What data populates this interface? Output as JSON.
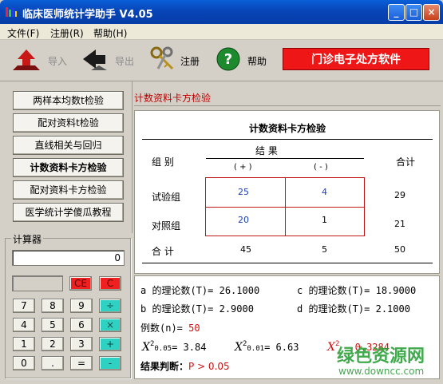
{
  "window": {
    "title": "临床医师统计学助手 V4.05",
    "minimize": "_",
    "maximize": "□",
    "close": "×"
  },
  "menu": {
    "items": [
      "文件(F)",
      "注册(R)",
      "帮助(H)"
    ]
  },
  "toolbar": {
    "import_label": "导入",
    "export_label": "导出",
    "register_label": "注册",
    "help_label": "帮助",
    "help_glyph": "?",
    "banner": "门诊电子处方软件"
  },
  "nav": {
    "items": [
      "两样本均数t检验",
      "配对资料t检验",
      "直线相关与回归",
      "计数资料卡方检验",
      "配对资料卡方检验",
      "医学统计学傻瓜教程"
    ],
    "active_index": 3
  },
  "calculator": {
    "title": "计算器",
    "display": "0",
    "ce": "CE",
    "c": "C",
    "keys": [
      "7",
      "8",
      "9",
      "÷",
      "4",
      "5",
      "6",
      "×",
      "1",
      "2",
      "3",
      "+",
      "0",
      ".",
      "=",
      "-"
    ]
  },
  "section_title": "计数资料卡方检验",
  "table": {
    "title": "计数资料卡方检验",
    "group_header": "组    别",
    "result_header": "结        果",
    "pos_header": "( + )",
    "neg_header": "( - )",
    "total_header": "合计",
    "rows": [
      {
        "label": "试验组",
        "pos": "25",
        "neg": "4",
        "total": "29"
      },
      {
        "label": "对照组",
        "pos": "20",
        "neg": "1",
        "total": "21"
      }
    ],
    "total_row": {
      "label": "合    计",
      "pos": "45",
      "neg": "5",
      "total": "50"
    }
  },
  "stats": {
    "a_label": "a 的理论数(T)=",
    "a_value": "26.1000",
    "b_label": "b 的理论数(T)=",
    "b_value": "2.9000",
    "c_label": "c 的理论数(T)=",
    "c_value": "18.9000",
    "d_label": "d 的理论数(T)=",
    "d_value": "2.1000",
    "n_label": "例数(n)=",
    "n_value": "50",
    "chi005_label": "0.05",
    "chi005_value": "= 3.84",
    "chi001_label": "0.01",
    "chi001_value": "= 6.63",
    "chi_value": "0.3284",
    "chi_symbol": "X",
    "chi_sup": "2",
    "conclusion_label": "结果判断：",
    "conclusion_value": "P > 0.05"
  },
  "watermark": {
    "brand": "绿色资源网",
    "url": "www.downcc.com"
  },
  "colors": {
    "titlebar": "#0845b8",
    "banner": "#ee1616",
    "highlight_red": "#d01010",
    "cell_blue": "#1b3fb8",
    "calc_teal": "#2fd1c2"
  }
}
